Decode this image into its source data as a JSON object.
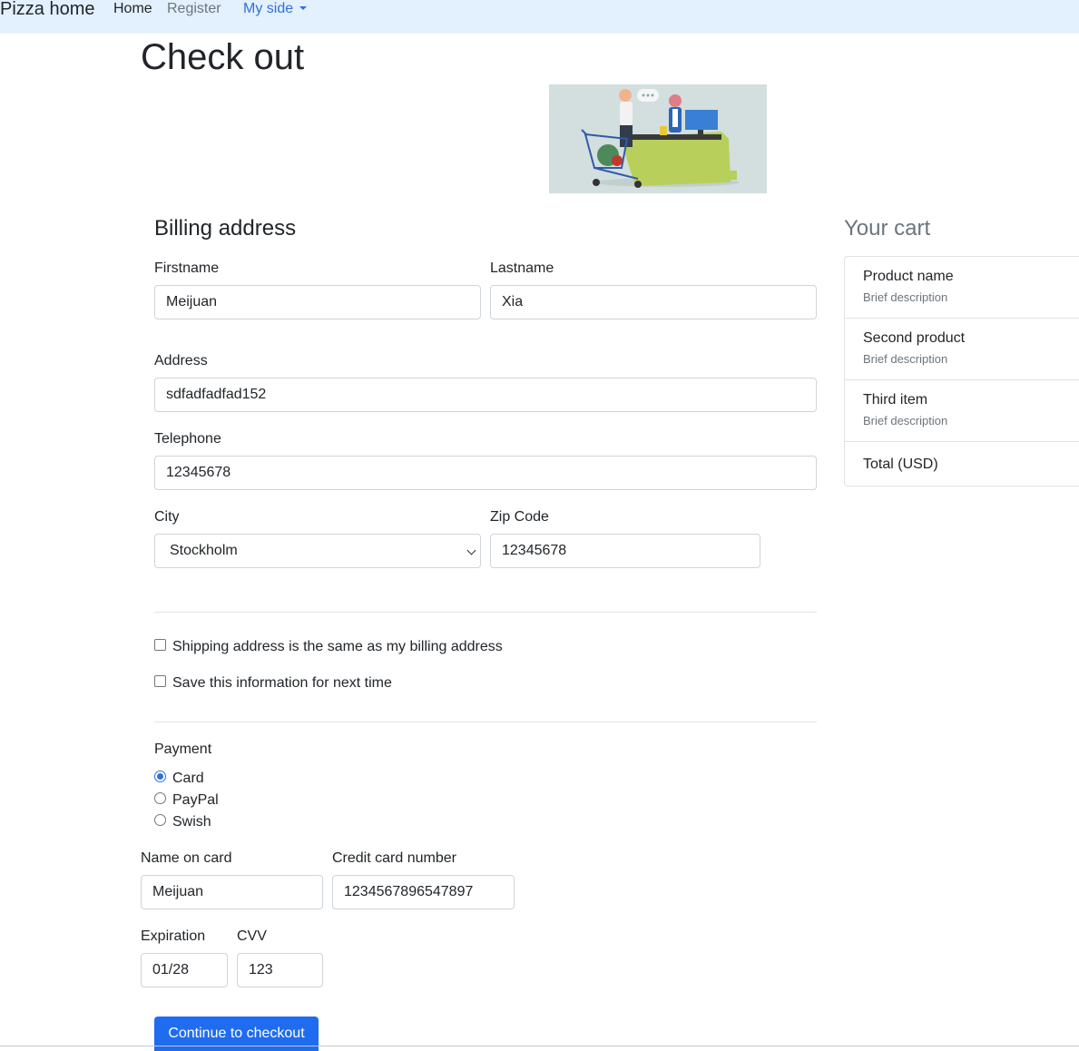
{
  "nav": {
    "brand": "Pizza home",
    "home": "Home",
    "register": "Register",
    "my_side": "My side"
  },
  "page_title": "Check out",
  "billing": {
    "title": "Billing address",
    "firstname_label": "Firstname",
    "firstname_value": "Meijuan",
    "lastname_label": "Lastname",
    "lastname_value": "Xia",
    "address_label": "Address",
    "address_value": "sdfadfadfad152",
    "telephone_label": "Telephone",
    "telephone_value": "12345678",
    "city_label": "City",
    "city_value": "Stockholm",
    "zip_label": "Zip Code",
    "zip_value": "12345678"
  },
  "options": {
    "same_address": "Shipping address is the same as my billing address",
    "save_info": "Save this information for next time"
  },
  "payment": {
    "label": "Payment",
    "methods": [
      "Card",
      "PayPal",
      "Swish"
    ],
    "selected": "Card",
    "name_on_card_label": "Name on card",
    "name_on_card_value": "Meijuan",
    "card_number_label": "Credit card number",
    "card_number_value": "1234567896547897",
    "expiration_label": "Expiration",
    "expiration_value": "01/28",
    "cvv_label": "CVV",
    "cvv_value": "123"
  },
  "cart": {
    "title": "Your cart",
    "items": [
      {
        "name": "Product name",
        "description": "Brief description"
      },
      {
        "name": "Second product",
        "description": "Brief description"
      },
      {
        "name": "Third item",
        "description": "Brief description"
      }
    ],
    "total_label": "Total (USD)"
  },
  "submit_label": "Continue to checkout",
  "colors": {
    "navbar_bg": "#e3f0fd",
    "primary": "#1f6cf0",
    "link": "#2f6fde"
  }
}
